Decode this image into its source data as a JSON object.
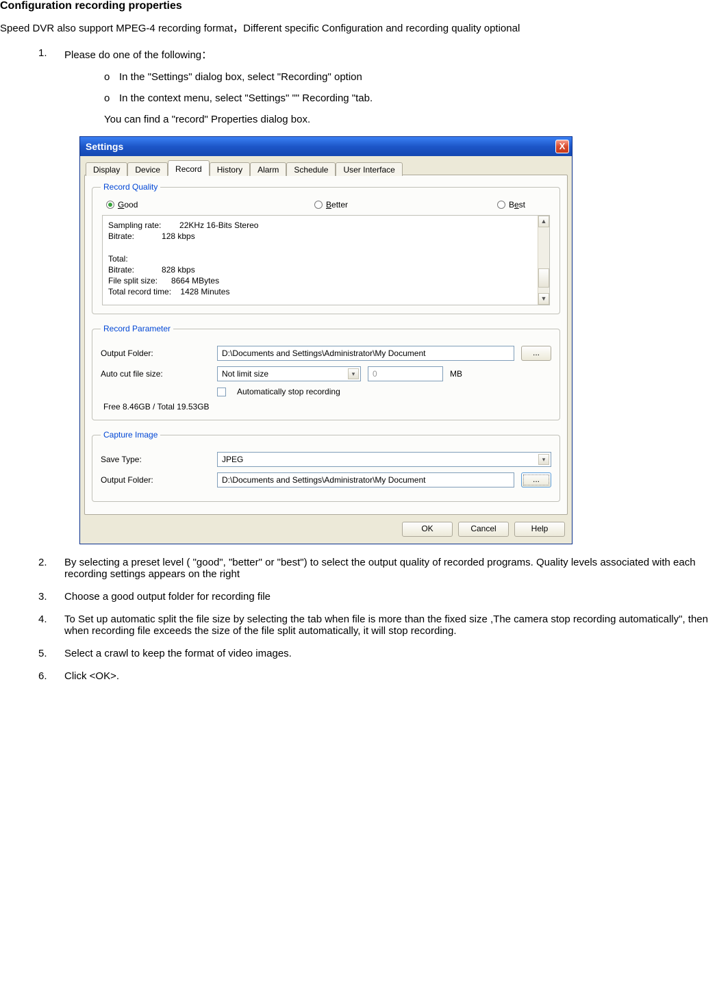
{
  "page": {
    "title": "Configuration recording properties",
    "intro": "Speed DVR also support MPEG-4 recording format，Different specific Configuration and recording quality optional",
    "step1": "Please do one of the following：",
    "step1_o1": "In the \"Settings\" dialog box, select \"Recording\" option",
    "step1_o2": "In the context menu, select \"Settings\" \"\" Recording \"tab.",
    "step1_note": "You can find a \"record\" Properties dialog box.",
    "step2": "By selecting a preset level ( \"good\", \"better\" or \"best\") to select the output quality of recorded programs. Quality levels associated with each recording settings appears on the right",
    "step3": "Choose a good output folder for recording file",
    "step4": "To Set up automatic split the file size by    selecting the tab when file is more than the fixed size ,The camera stop recording automatically\", then when recording file exceeds the size of the file split automatically, it will stop recording.",
    "step5": "Select a crawl to keep the format of video images.",
    "step6": "Click <OK>."
  },
  "dialog": {
    "title": "Settings",
    "close": "X",
    "tabs": [
      "Display",
      "Device",
      "Record",
      "History",
      "Alarm",
      "Schedule",
      "User Interface"
    ],
    "active_tab_index": 2,
    "groups": {
      "quality": {
        "legend": "Record Quality",
        "options": {
          "good": "G",
          "good_rest": "ood",
          "better": "B",
          "better_rest": "etter",
          "best": "B",
          "best_u": "e",
          "best_rest": "st"
        },
        "info": {
          "sampling_label": "Sampling rate:",
          "sampling_value": "22KHz 16-Bits Stereo",
          "bitrate_label": "Bitrate:",
          "bitrate_value": "128 kbps",
          "total_label": "Total:",
          "tbitrate_label": "Bitrate:",
          "tbitrate_value": "828 kbps",
          "split_label": "File split size:",
          "split_value": "8664 MBytes",
          "time_label": "Total record time:",
          "time_value": "1428 Minutes"
        }
      },
      "param": {
        "legend": "Record Parameter",
        "output_folder_label": "Output Folder:",
        "output_folder_value": "D:\\Documents and Settings\\Administrator\\My Document",
        "browse": "...",
        "auto_cut_label": "Auto cut file size:",
        "auto_cut_select": "Not limit size",
        "auto_cut_number": "0",
        "auto_cut_unit": "MB",
        "auto_stop_label": "Automatically stop recording",
        "free_total": "Free 8.46GB / Total 19.53GB"
      },
      "capture": {
        "legend": "Capture Image",
        "save_type_label": "Save Type:",
        "save_type_value": "JPEG",
        "output_folder_label": "Output Folder:",
        "output_folder_value": "D:\\Documents and Settings\\Administrator\\My Document",
        "browse": "..."
      }
    },
    "buttons": {
      "ok": "OK",
      "cancel": "Cancel",
      "help": "Help"
    }
  }
}
